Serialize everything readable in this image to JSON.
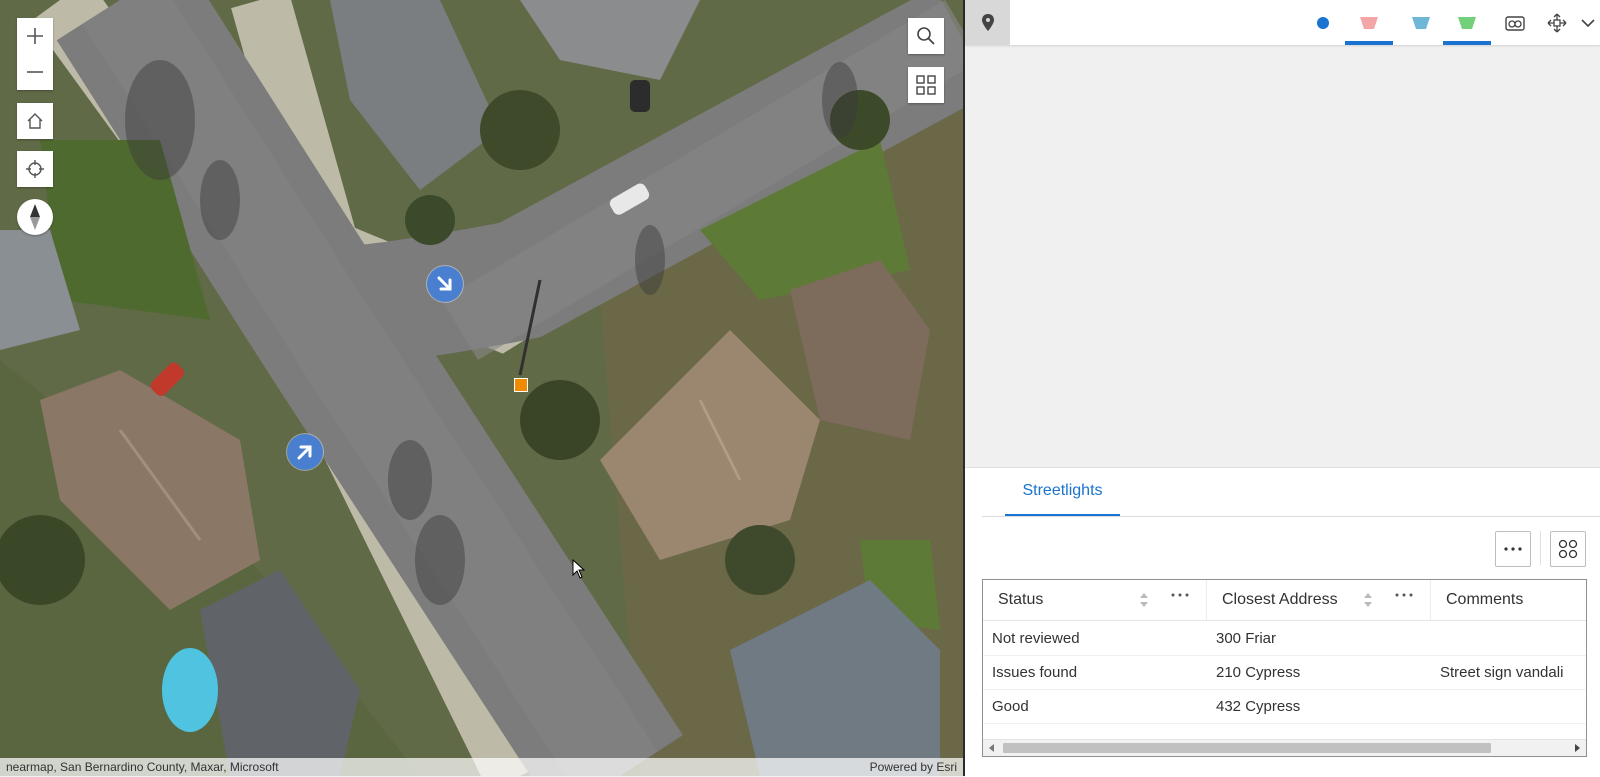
{
  "map": {
    "attribution_left": "nearmap, San Bernardino County, Maxar, Microsoft",
    "attribution_right": "Powered by Esri",
    "controls": {
      "zoom_in": "+",
      "zoom_out": "−"
    }
  },
  "toolbar": {
    "icons": [
      "pin-icon",
      "point-icon",
      "red-feature-icon",
      "blue-feature-icon",
      "green-feature-icon",
      "camera-icon",
      "move-icon",
      "chevron-down-icon"
    ],
    "colors": {
      "point": "#1a73d0",
      "red": "#f4a6a6",
      "blue": "#6fb7d6",
      "green": "#72d07a",
      "active_underline": "#1a73d0"
    }
  },
  "table": {
    "tab_label": "Streetlights",
    "columns": [
      "Status",
      "Closest Address",
      "Comments"
    ],
    "rows": [
      {
        "status": "Not reviewed",
        "address": "300 Friar",
        "comments": ""
      },
      {
        "status": "Issues found",
        "address": "210 Cypress",
        "comments": "Street sign vandali"
      },
      {
        "status": "Good",
        "address": "432 Cypress",
        "comments": ""
      }
    ]
  }
}
